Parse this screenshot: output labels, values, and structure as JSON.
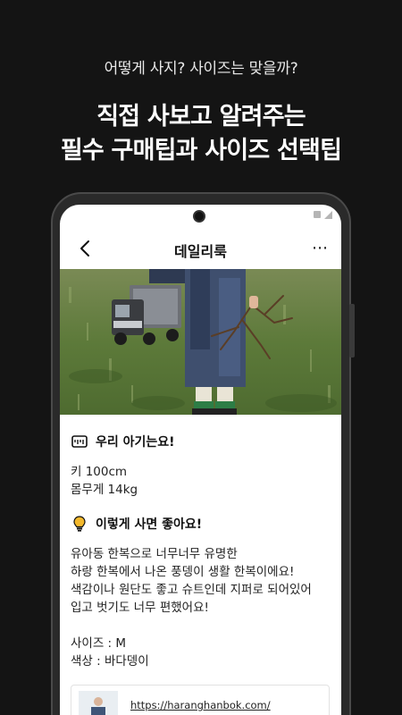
{
  "promo": {
    "subtitle": "어떻게 사지? 사이즈는 맞을까?",
    "title_line1": "직접 사보고 알려주는",
    "title_line2": "필수 구매팁과 사이즈 선택팁"
  },
  "app": {
    "header_title": "데일리룩",
    "more_label": "⋯"
  },
  "baby_section": {
    "title": "우리 아기는요!",
    "height": "키 100cm",
    "weight": "몸무게 14kg"
  },
  "recommend_section": {
    "title": "이렇게 사면 좋아요!",
    "line1": "유아동 한복으로 너무너무 유명한",
    "line2": "하랑 한복에서 나온 풍뎅이 생활 한복이에요!",
    "line3": "색감이나 원단도 좋고 슈트인데 지퍼로 되어있어",
    "line4": "입고 벗기도 너무 편했어요!",
    "size": "사이즈 : M",
    "color": "색상 : 바다뎅이"
  },
  "link_card": {
    "url": "https://haranghanbok.com/"
  },
  "colors": {
    "background": "#141414",
    "screen": "#ffffff",
    "accent_bulb": "#f3b82c"
  }
}
